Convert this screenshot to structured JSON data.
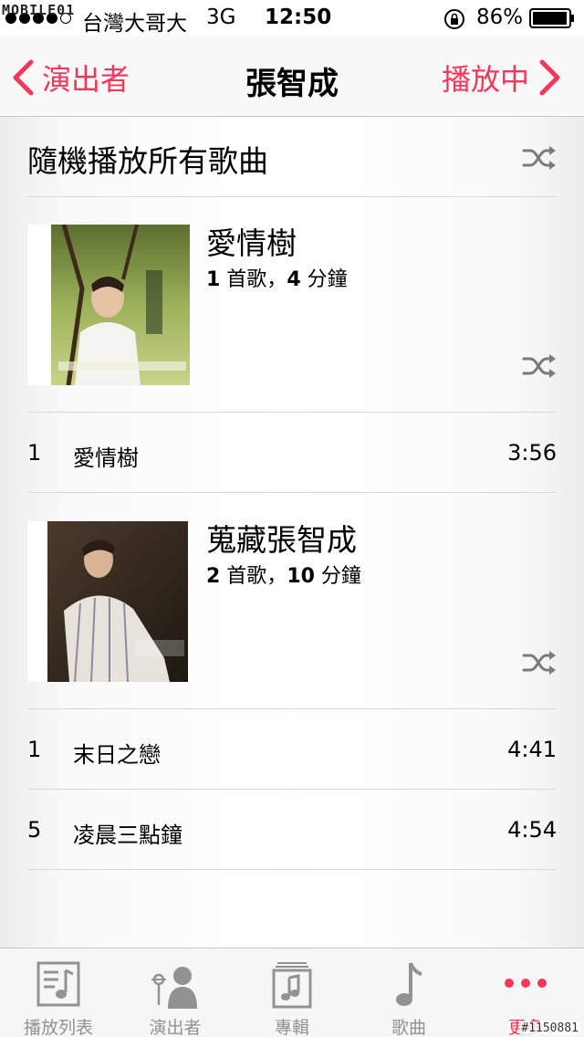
{
  "status_bar": {
    "watermark": "MOBILE01",
    "carrier": "台灣大哥大",
    "network": "3G",
    "time": "12:50",
    "battery_percent": "86%"
  },
  "nav_bar": {
    "back_label": "演出者",
    "title": "張智成",
    "now_playing_label": "播放中"
  },
  "shuffle_all": {
    "label": "隨機播放所有歌曲"
  },
  "albums": [
    {
      "title": "愛情樹",
      "song_count": "1",
      "song_unit": " 首歌，",
      "minutes": "4",
      "minutes_unit": " 分鐘",
      "tracks": [
        {
          "number": "1",
          "name": "愛情樹",
          "duration": "3:56"
        }
      ]
    },
    {
      "title": "蒐藏張智成",
      "song_count": "2",
      "song_unit": " 首歌，",
      "minutes": "10",
      "minutes_unit": " 分鐘",
      "tracks": [
        {
          "number": "1",
          "name": "末日之戀",
          "duration": "4:41"
        },
        {
          "number": "5",
          "name": "凌晨三點鐘",
          "duration": "4:54"
        }
      ]
    }
  ],
  "tab_bar": {
    "tabs": [
      {
        "label": "播放列表",
        "icon": "playlist-icon"
      },
      {
        "label": "演出者",
        "icon": "artist-icon"
      },
      {
        "label": "專輯",
        "icon": "album-icon"
      },
      {
        "label": "歌曲",
        "icon": "song-icon"
      },
      {
        "label": "更多",
        "icon": "more-icon"
      }
    ],
    "active_index": 4
  },
  "watermark_bottom": "#1150881",
  "colors": {
    "accent": "#f2385a",
    "tab_inactive": "#929292"
  }
}
